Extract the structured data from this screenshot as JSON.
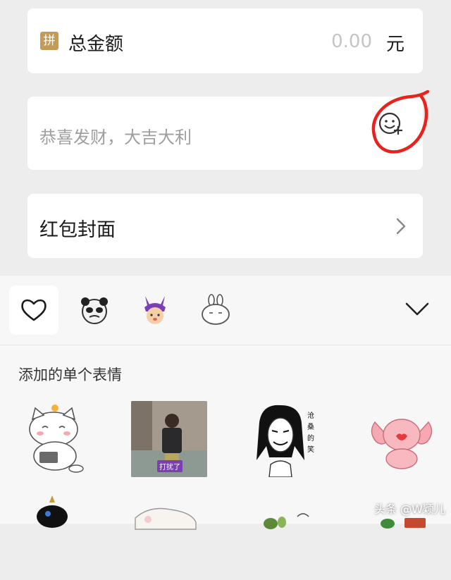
{
  "amount": {
    "pin_icon_char": "拼",
    "label": "总金额",
    "value": "0.00",
    "unit": "元"
  },
  "greeting": {
    "placeholder": "恭喜发财，大吉大利"
  },
  "cover": {
    "label": "红包封面"
  },
  "emoji_panel": {
    "tabs": [
      "heart-icon",
      "panda-sticker-icon",
      "purple-bunny-sticker-icon",
      "white-bunny-sticker-icon"
    ],
    "section_title": "添加的单个表情",
    "stickers": [
      {
        "name": "cat-sticker"
      },
      {
        "name": "toddler-photo-sticker",
        "caption": "打扰了"
      },
      {
        "name": "long-hair-man-sticker",
        "caption": "沧桑的笑"
      },
      {
        "name": "pink-elephant-sticker"
      }
    ]
  },
  "watermark": "头条 @W颖儿",
  "colors": {
    "background": "#ededed",
    "card": "#ffffff",
    "pin_gold": "#c29b58",
    "annotation_red": "#e8231d"
  }
}
